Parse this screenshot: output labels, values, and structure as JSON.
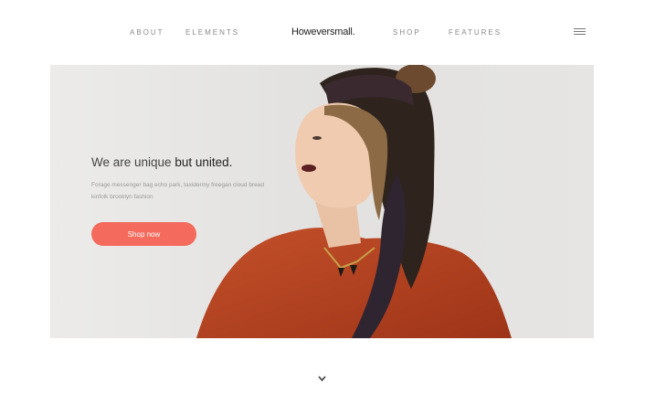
{
  "nav": {
    "links_left": [
      "ABOUT",
      "ELEMENTS"
    ],
    "logo": "Howeversmall.",
    "links_right": [
      "SHOP",
      "FEATURES"
    ],
    "menu_icon": "hamburger-menu-icon"
  },
  "hero": {
    "headline_regular": "We are unique ",
    "headline_bold": "but united.",
    "subtext": "Forage messenger bag echo park, taxidermy freegan cloud bread kinfolk brooklyn fashion",
    "cta_label": "Shop now",
    "image": "woman-in-rust-dress-photo"
  },
  "scroll": {
    "icon": "chevron-down-icon"
  },
  "colors": {
    "accent": "#f46b5d",
    "dress": "#b8401f",
    "hero_bg": "#e5e4e2"
  }
}
